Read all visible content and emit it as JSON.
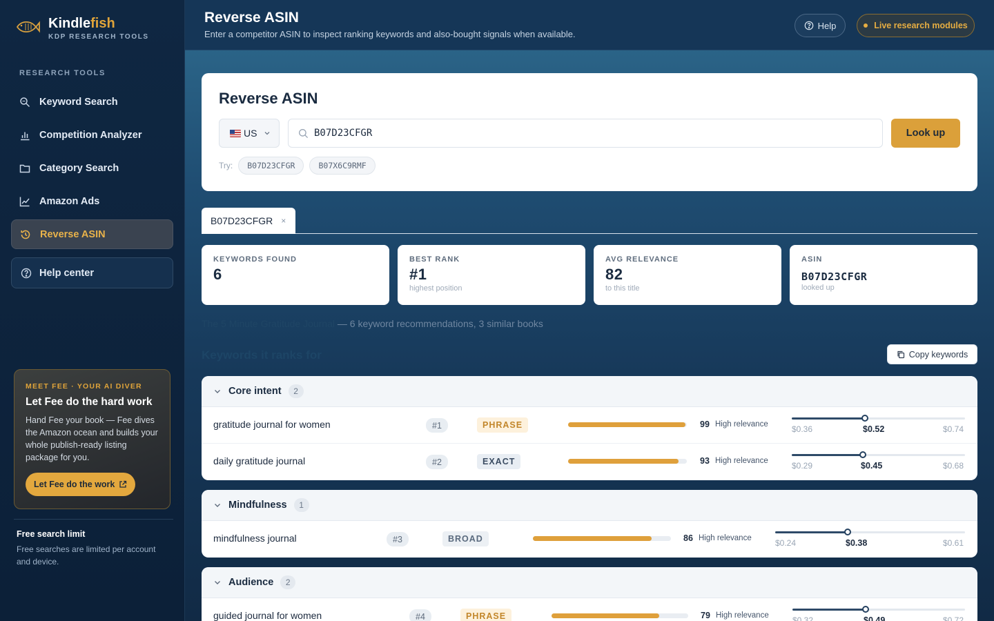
{
  "brand": {
    "name_main": "Kindle",
    "name_accent": "fish",
    "tagline": "KDP RESEARCH TOOLS"
  },
  "sidebar": {
    "section_label": "RESEARCH TOOLS",
    "items": [
      {
        "label": "Keyword Search",
        "icon": "search-icon"
      },
      {
        "label": "Competition Analyzer",
        "icon": "bar-chart-icon"
      },
      {
        "label": "Category Search",
        "icon": "folder-icon"
      },
      {
        "label": "Amazon Ads",
        "icon": "line-chart-icon"
      },
      {
        "label": "Reverse ASIN",
        "icon": "history-icon",
        "active": true
      }
    ],
    "help_center": "Help center",
    "promo": {
      "kicker": "MEET FEE · YOUR AI DIVER",
      "title": "Let Fee do the hard work",
      "text": "Hand Fee your book — Fee dives the Amazon ocean and builds your whole publish-ready listing package for you.",
      "button": "Let Fee do the work"
    },
    "limit": {
      "title": "Free search limit",
      "text": "Free searches are limited per account and device."
    }
  },
  "header": {
    "title": "Reverse ASIN",
    "subtitle": "Enter a competitor ASIN to inspect ranking keywords and also-bought signals when available.",
    "help": "Help",
    "live": "Live research modules"
  },
  "search": {
    "title": "Reverse ASIN",
    "market": "US",
    "value": "B07D23CFGR",
    "button": "Look up",
    "try_label": "Try:",
    "examples": [
      "B07D23CFGR",
      "B07X6C9RMF"
    ]
  },
  "tab": {
    "label": "B07D23CFGR",
    "close": "×"
  },
  "stats": [
    {
      "label": "KEYWORDS FOUND",
      "value": "6",
      "sub": ""
    },
    {
      "label": "BEST RANK",
      "value": "#1",
      "sub": "highest position"
    },
    {
      "label": "AVG RELEVANCE",
      "value": "82",
      "sub": "to this title"
    },
    {
      "label": "ASIN",
      "value": "B07D23CFGR",
      "sub": "looked up"
    }
  ],
  "summary": {
    "book": "The 5 Minute Gratitude Journal",
    "rest": " — 6 keyword recommendations, 3 similar books"
  },
  "section_title": "Keywords it ranks for",
  "copy_button": "Copy keywords",
  "groups": [
    {
      "name": "Core intent",
      "count": "2",
      "rows": [
        {
          "keyword": "gratitude journal for women",
          "rank": "#1",
          "match": "PHRASE",
          "relevance": 99,
          "relevance_label": "High relevance",
          "bid_low": "$0.36",
          "bid_mid": "$0.52",
          "bid_high": "$0.74"
        },
        {
          "keyword": "daily gratitude journal",
          "rank": "#2",
          "match": "EXACT",
          "relevance": 93,
          "relevance_label": "High relevance",
          "bid_low": "$0.29",
          "bid_mid": "$0.45",
          "bid_high": "$0.68"
        }
      ]
    },
    {
      "name": "Mindfulness",
      "count": "1",
      "rows": [
        {
          "keyword": "mindfulness journal",
          "rank": "#3",
          "match": "BROAD",
          "relevance": 86,
          "relevance_label": "High relevance",
          "bid_low": "$0.24",
          "bid_mid": "$0.38",
          "bid_high": "$0.61"
        }
      ]
    },
    {
      "name": "Audience",
      "count": "2",
      "rows": [
        {
          "keyword": "guided journal for women",
          "rank": "#4",
          "match": "PHRASE",
          "relevance": 79,
          "relevance_label": "High relevance",
          "bid_low": "$0.32",
          "bid_mid": "$0.49",
          "bid_high": "$0.72"
        }
      ]
    }
  ],
  "colors": {
    "accent": "#dba03a",
    "navy": "#0f2742",
    "bar": "#dfa03b"
  }
}
